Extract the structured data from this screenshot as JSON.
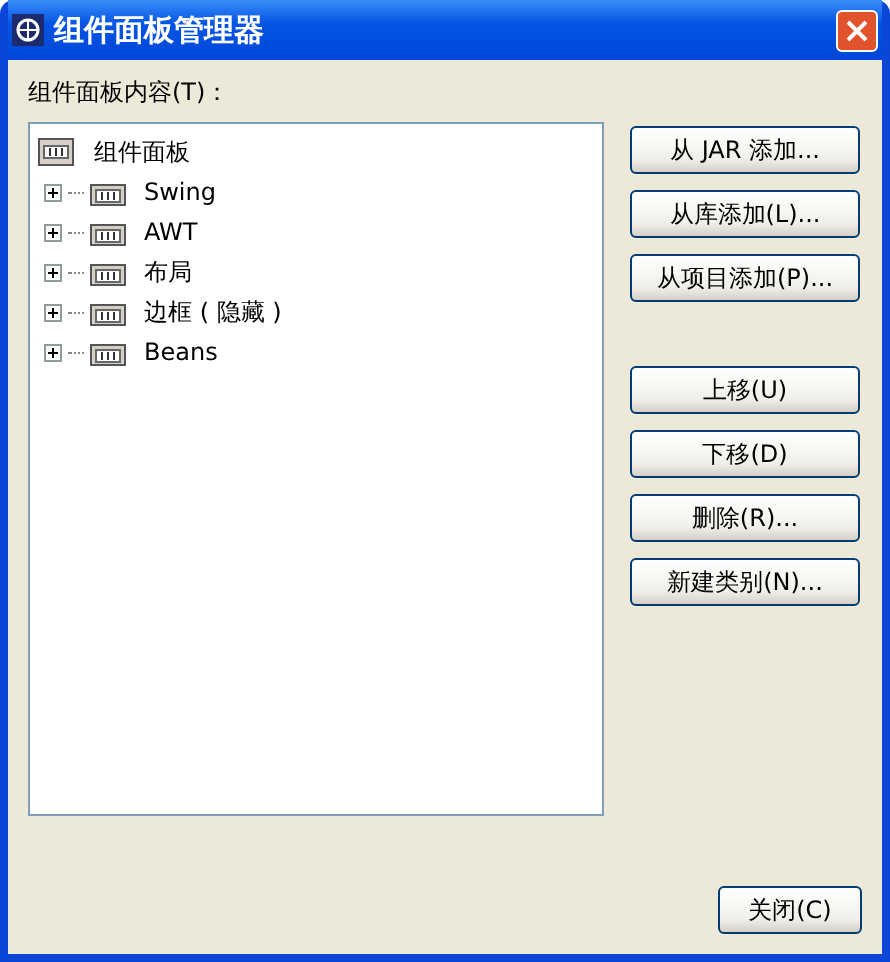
{
  "window": {
    "title": "组件面板管理器"
  },
  "tree_label": "组件面板内容(T)：",
  "tree": {
    "label": "组件面板",
    "children": [
      {
        "label": "Swing",
        "expanded": false
      },
      {
        "label": "AWT",
        "expanded": false
      },
      {
        "label": "布局",
        "expanded": false
      },
      {
        "label": "边框 ( 隐藏 )",
        "expanded": false
      },
      {
        "label": "Beans",
        "expanded": false
      }
    ]
  },
  "button_groups": [
    [
      "从 JAR 添加...",
      "从库添加(L)...",
      "从项目添加(P)..."
    ],
    [
      "上移(U)",
      "下移(D)",
      "删除(R)...",
      "新建类别(N)..."
    ]
  ],
  "close_button": "关闭(C)"
}
